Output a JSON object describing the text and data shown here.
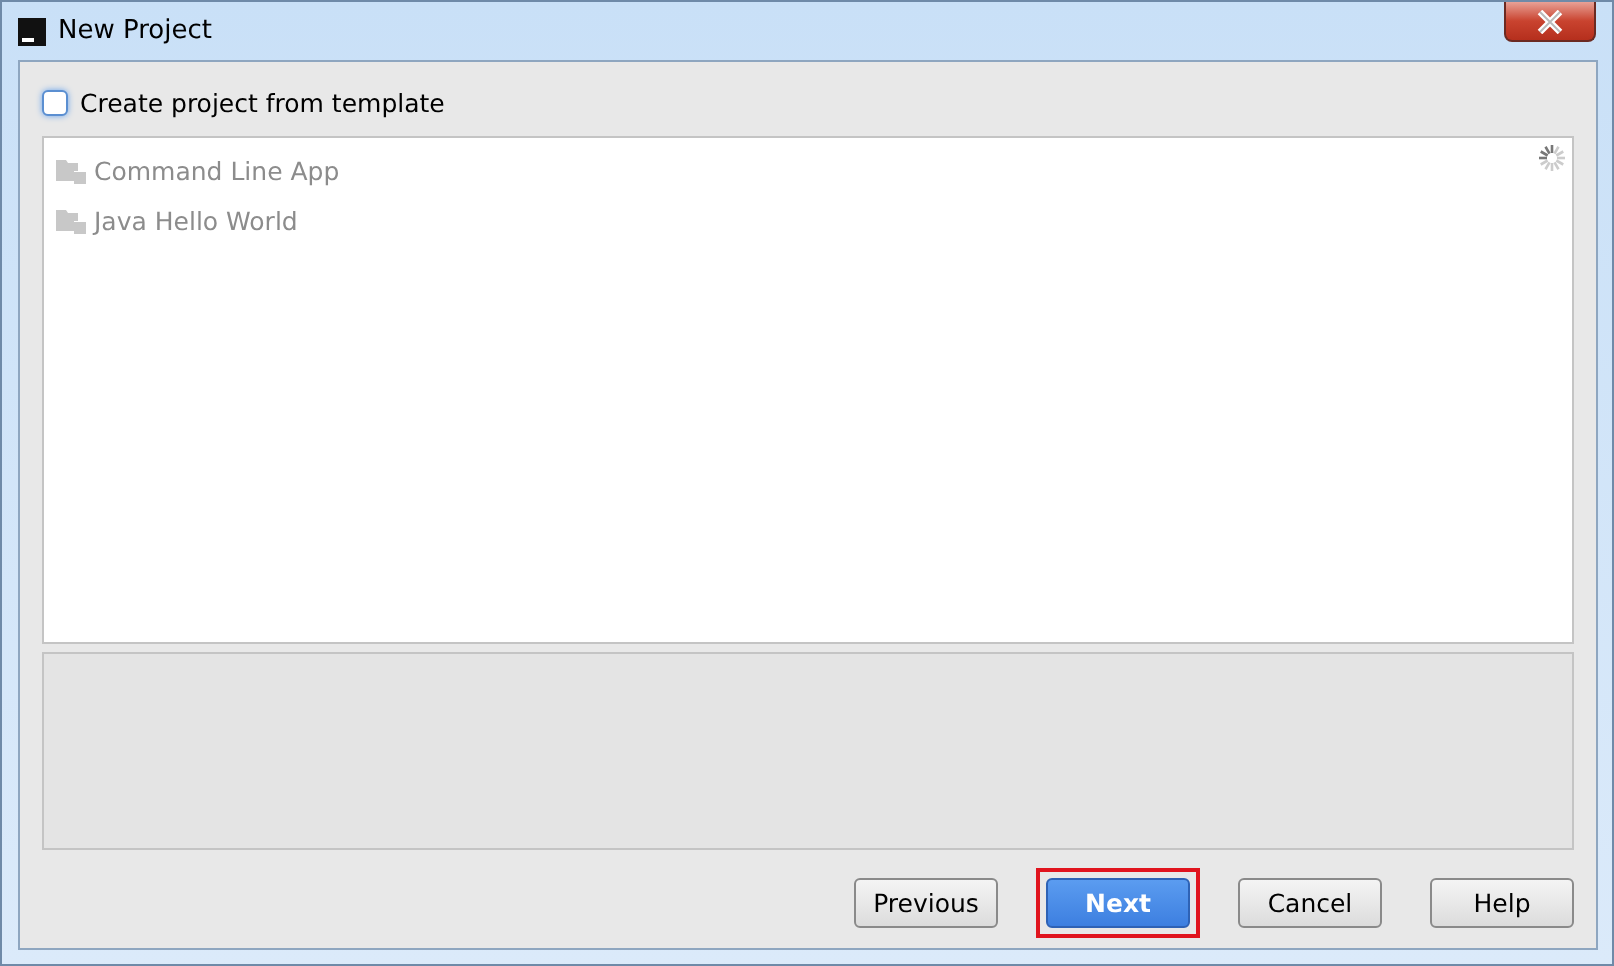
{
  "window": {
    "title": "New Project"
  },
  "template_checkbox": {
    "label": "Create project from template",
    "checked": false
  },
  "templates": [
    {
      "label": "Command Line App",
      "disabled": true
    },
    {
      "label": "Java Hello World",
      "disabled": true
    }
  ],
  "loading": true,
  "buttons": [
    {
      "label": "Previous",
      "default": false,
      "highlighted": false
    },
    {
      "label": "Next",
      "default": true,
      "highlighted": true
    },
    {
      "label": "Cancel",
      "default": false,
      "highlighted": false
    },
    {
      "label": "Help",
      "default": false,
      "highlighted": false
    }
  ]
}
